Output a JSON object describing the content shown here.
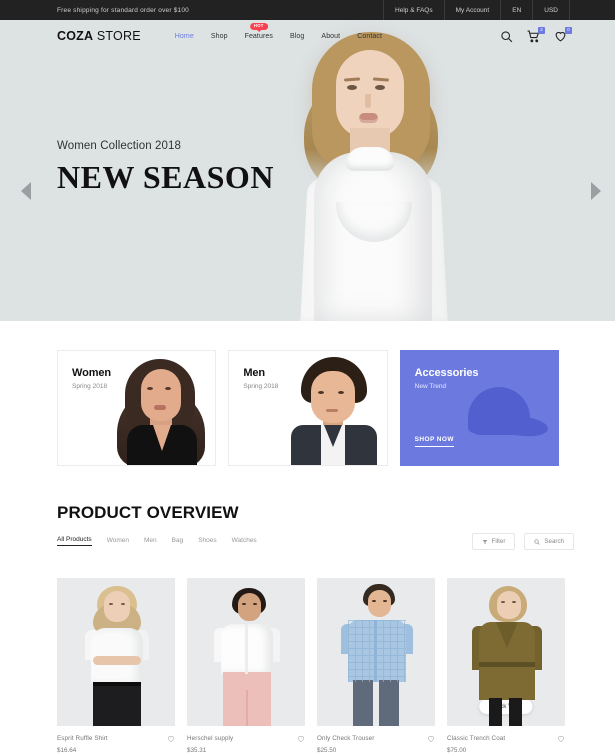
{
  "topbar": {
    "notice": "Free shipping for standard order over $100",
    "links": [
      {
        "label": "Help & FAQs"
      },
      {
        "label": "My Account"
      },
      {
        "label": "EN"
      },
      {
        "label": "USD"
      }
    ]
  },
  "header": {
    "logo_bold": "COZA",
    "logo_light": " STORE",
    "nav": [
      {
        "label": "Home",
        "active": true,
        "badge": ""
      },
      {
        "label": "Shop",
        "active": false,
        "badge": ""
      },
      {
        "label": "Features",
        "active": false,
        "badge": "HOT"
      },
      {
        "label": "Blog",
        "active": false,
        "badge": ""
      },
      {
        "label": "About",
        "active": false,
        "badge": ""
      },
      {
        "label": "Contact",
        "active": false,
        "badge": ""
      }
    ],
    "cart_count": "2",
    "wishlist_count": "0"
  },
  "hero": {
    "subtitle": "Women Collection 2018",
    "title": "NEW SEASON",
    "background_color": "#dde2e3"
  },
  "categories": [
    {
      "name": "Women",
      "season": "Spring 2018"
    },
    {
      "name": "Men",
      "season": "Spring 2018"
    },
    {
      "name": "Accessories",
      "season": "New Trend",
      "cta": "SHOP NOW",
      "accent": "#6c7ae0"
    }
  ],
  "product_overview": {
    "title": "PRODUCT OVERVIEW",
    "filter_tabs": [
      {
        "label": "All Products",
        "active": true
      },
      {
        "label": "Women",
        "active": false
      },
      {
        "label": "Men",
        "active": false
      },
      {
        "label": "Bag",
        "active": false
      },
      {
        "label": "Shoes",
        "active": false
      },
      {
        "label": "Watches",
        "active": false
      }
    ],
    "filter_button": "Filter",
    "search_button": "Search",
    "quick_view_label": "Quick View",
    "products": [
      {
        "name": "Esprit Ruffle Shirt",
        "price": "$16.64"
      },
      {
        "name": "Herschel supply",
        "price": "$35.31"
      },
      {
        "name": "Only Check Trouser",
        "price": "$25.50"
      },
      {
        "name": "Classic Trench Coat",
        "price": "$75.00"
      }
    ]
  }
}
